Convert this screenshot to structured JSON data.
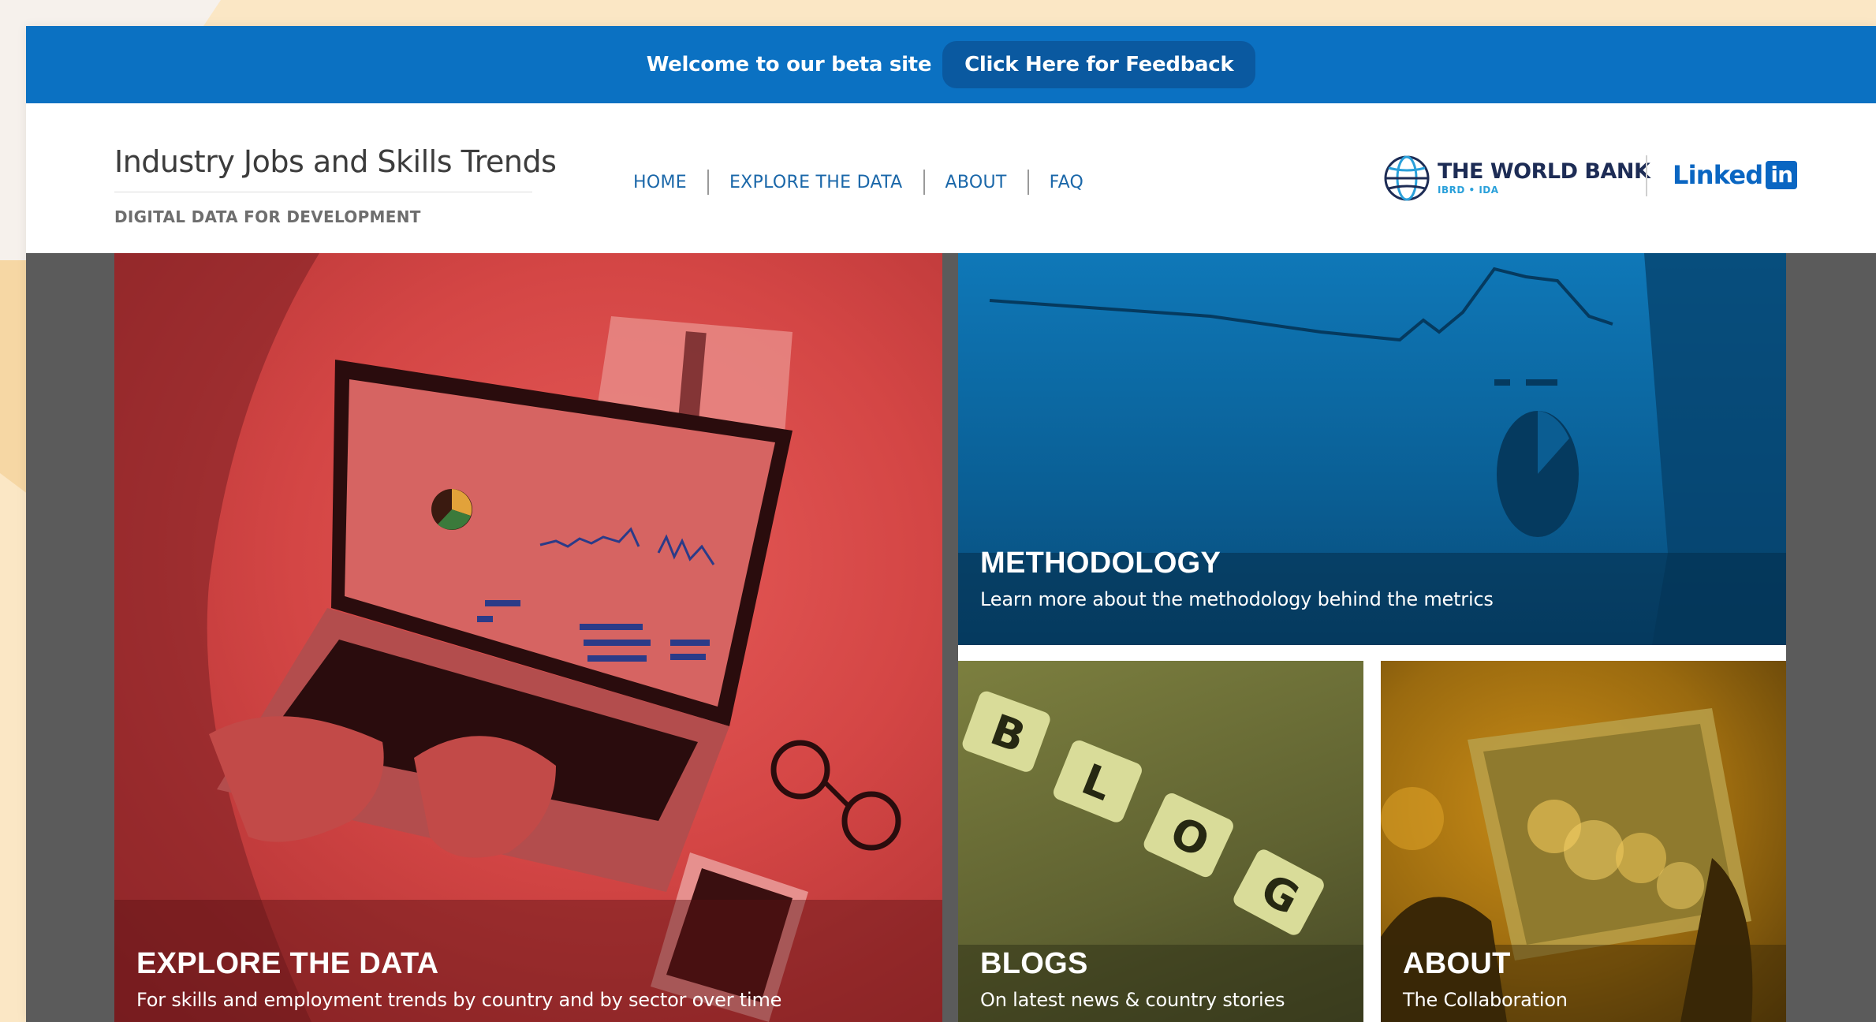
{
  "banner": {
    "welcome_text": "Welcome to our beta site",
    "feedback_label": "Click Here for Feedback"
  },
  "header": {
    "title": "Industry Jobs and Skills Trends",
    "subtitle": "DIGITAL DATA FOR DEVELOPMENT",
    "nav": [
      "HOME",
      "EXPLORE THE DATA",
      "ABOUT",
      "FAQ"
    ],
    "world_bank": {
      "name": "THE WORLD BANK",
      "sub": "IBRD • IDA"
    },
    "linkedin": {
      "word": "Linked",
      "badge": "in"
    }
  },
  "tiles": {
    "explore": {
      "title": "EXPLORE THE DATA",
      "desc": "For skills and employment trends by country and by sector over time"
    },
    "methodology": {
      "title": "METHODOLOGY",
      "desc": "Learn more about the methodology behind the metrics"
    },
    "blogs": {
      "title": "BLOGS",
      "desc": "On latest news & country stories",
      "tiles_letters": [
        "B",
        "L",
        "O",
        "G"
      ]
    },
    "about": {
      "title": "ABOUT",
      "desc": "The Collaboration"
    }
  },
  "colors": {
    "banner": "#0b71c2",
    "nav_link": "#1a67a9",
    "explore_tint": "#d44645",
    "methodology_tint": "#0f78b8",
    "blogs_tint": "#7c7f3f",
    "about_tint": "#c88b17"
  }
}
